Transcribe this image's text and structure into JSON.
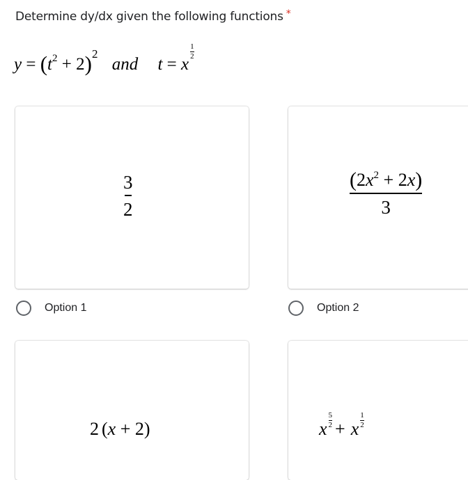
{
  "question": {
    "title": "Determine dy/dx given the following functions",
    "required_marker": "*",
    "equation": {
      "lhs_y": "y",
      "equals": "=",
      "open_paren": "(",
      "t": "t",
      "t_exp": "2",
      "plus_two": "+ 2",
      "close_paren": ")",
      "outer_exp": "2",
      "and": "and",
      "lhs_t": "t",
      "x": "x",
      "x_exp_num": "1",
      "x_exp_den": "2"
    }
  },
  "options": [
    {
      "label": "Option 1",
      "selected": false,
      "math": {
        "numerator": "3",
        "denominator": "2"
      }
    },
    {
      "label": "Option 2",
      "selected": false,
      "math": {
        "open": "(",
        "coef1": "2",
        "x": "x",
        "exp": "2",
        "mid": " + 2",
        "x2": "x",
        "close": ")",
        "denominator": "3"
      }
    },
    {
      "label": "",
      "selected": false,
      "math": {
        "coef": "2",
        "open": "(",
        "x": "x",
        "rest": " + 2",
        "close": ")"
      }
    },
    {
      "label": "",
      "selected": false,
      "math": {
        "x1": "x",
        "exp1_num": "5",
        "exp1_den": "2",
        "plus": "+",
        "x2": "x",
        "exp2_num": "1",
        "exp2_den": "2"
      }
    }
  ],
  "colors": {
    "required": "#d93025",
    "text": "#202124",
    "radio_border": "#5f6368"
  }
}
